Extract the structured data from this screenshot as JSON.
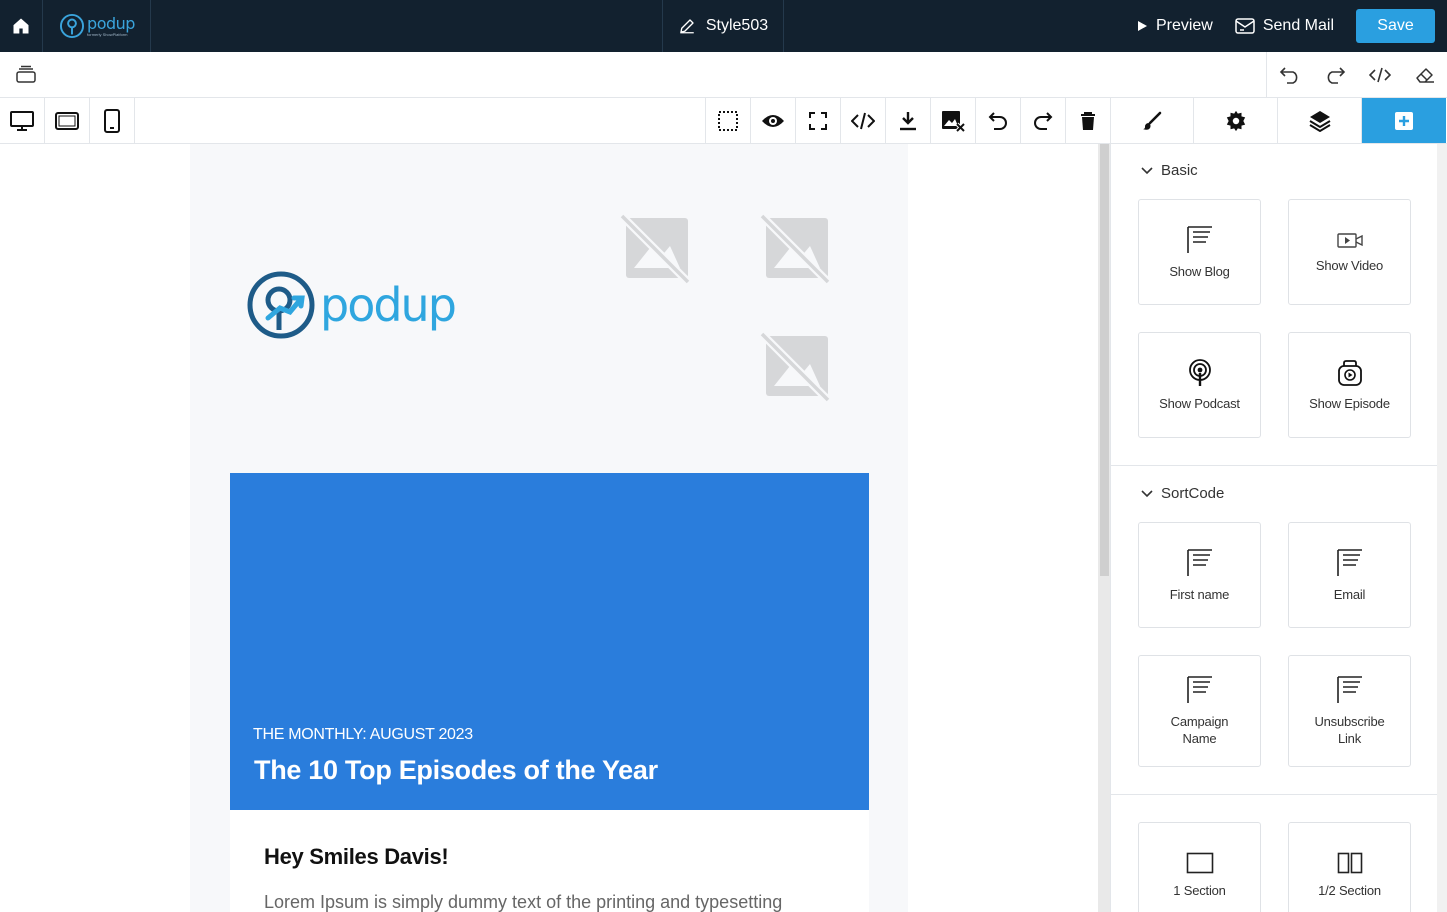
{
  "topbar": {
    "brand_name": "podup",
    "brand_tagline": "formerly ShowPlatform",
    "template_name": "Style503",
    "preview_label": "Preview",
    "send_mail_label": "Send Mail",
    "save_label": "Save"
  },
  "email": {
    "logo_text": "podup",
    "hero_kicker": "THE MONTHLY: AUGUST 2023",
    "hero_title": "The 10 Top Episodes of the Year",
    "greeting": "Hey Smiles Davis!",
    "body": "Lorem Ipsum is simply dummy text of the printing and typesetting"
  },
  "panel": {
    "sections": [
      {
        "title": "Basic",
        "blocks": [
          {
            "label": "Show Blog",
            "icon": "text-lines-icon"
          },
          {
            "label": "Show Video",
            "icon": "video-icon"
          },
          {
            "label": "Show Podcast",
            "icon": "podcast-icon"
          },
          {
            "label": "Show Episode",
            "icon": "episode-icon"
          }
        ]
      },
      {
        "title": "SortCode",
        "blocks": [
          {
            "label": "First name",
            "icon": "text-lines-icon"
          },
          {
            "label": "Email",
            "icon": "text-lines-icon"
          },
          {
            "label": "Campaign Name",
            "icon": "text-lines-icon"
          },
          {
            "label": "Unsubscribe Link",
            "icon": "text-lines-icon"
          }
        ]
      },
      {
        "title": "",
        "blocks": [
          {
            "label": "1 Section",
            "icon": "one-section-icon"
          },
          {
            "label": "1/2 Section",
            "icon": "half-section-icon"
          }
        ]
      }
    ]
  },
  "colors": {
    "topbar_bg": "#12212f",
    "accent": "#2a9fe0",
    "hero_bg": "#2a7ddc"
  }
}
